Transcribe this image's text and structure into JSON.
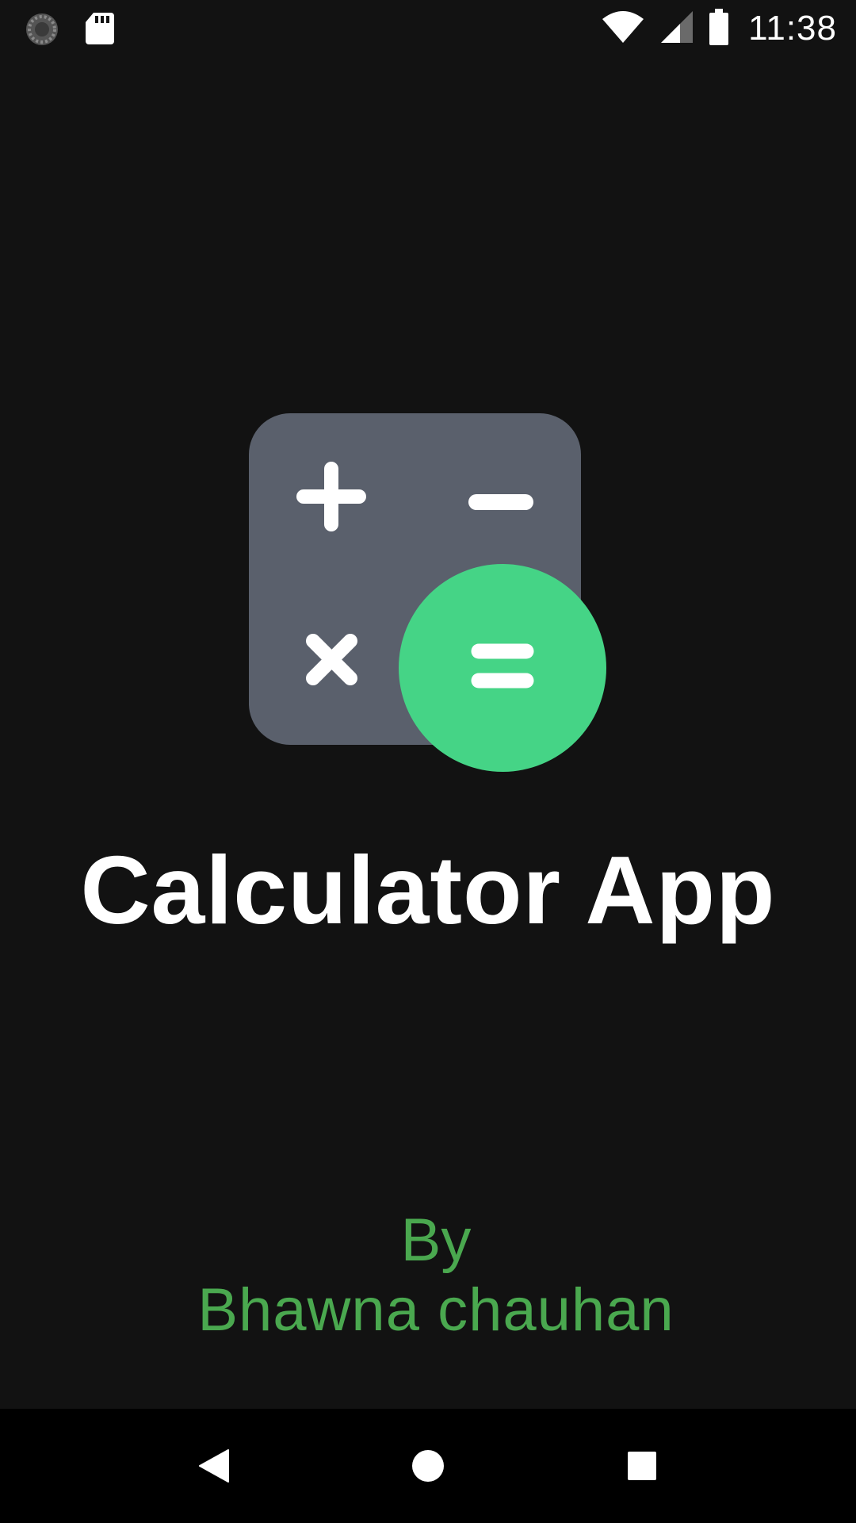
{
  "status_bar": {
    "time": "11:38",
    "left_icons": [
      "sync-icon",
      "sd-card-icon"
    ],
    "right_icons": [
      "wifi-icon",
      "cellular-signal-icon",
      "battery-icon"
    ]
  },
  "logo": {
    "icon": "calculator-icon",
    "card_color": "#5a606c",
    "equals_color": "#45d486",
    "symbols": [
      "plus-icon",
      "minus-icon",
      "multiply-icon",
      "equals-icon"
    ]
  },
  "title": "Calculator App",
  "byline": {
    "by": "By",
    "author": "Bhawna chauhan",
    "color": "#4aa84f"
  },
  "nav_bar": {
    "buttons": [
      "back-icon",
      "home-icon",
      "recents-icon"
    ]
  }
}
